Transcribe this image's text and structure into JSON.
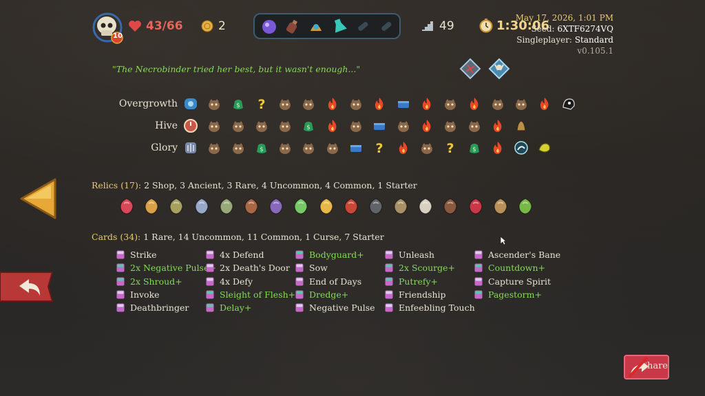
{
  "player": {
    "hp": "43/66",
    "gold": "2",
    "ascension": "10"
  },
  "potions": [
    "purple-potion",
    "brown-bottle-potion",
    "swirl-potion",
    "teal-flask-potion",
    "empty-slot",
    "empty-slot"
  ],
  "floor": "49",
  "timer": "1:30:06",
  "info": {
    "date": "May 17, 2026, 1:01 PM",
    "seed_label": "Seed:",
    "seed": "6XTF6274VQ",
    "mode_label": "Singleplayer:",
    "mode": "Standard",
    "version": "v0.105.1"
  },
  "quote": "\"The Necrobinder tried her best, but it wasn't enough...\"",
  "acts": [
    {
      "name": "Overgrowth",
      "nodes": [
        "ancient-blue",
        "monster",
        "shop",
        "unknown",
        "monster",
        "monster",
        "elite",
        "monster",
        "elite",
        "chest",
        "elite",
        "monster",
        "elite",
        "monster",
        "monster",
        "elite",
        "boss-black"
      ]
    },
    {
      "name": "Hive",
      "nodes": [
        "ancient-clock",
        "monster",
        "monster",
        "monster",
        "monster",
        "shop",
        "elite",
        "monster",
        "chest",
        "monster",
        "elite",
        "monster",
        "monster",
        "elite",
        "boss-bell"
      ]
    },
    {
      "name": "Glory",
      "nodes": [
        "ancient-grey",
        "monster",
        "monster",
        "shop",
        "monster",
        "monster",
        "monster",
        "chest",
        "unknown",
        "elite",
        "monster",
        "unknown",
        "shop",
        "elite",
        "boss-teal",
        "boss-yellow"
      ]
    }
  ],
  "relics": {
    "label": "Relics (17):",
    "summary": "2 Shop,  3 Ancient,  3 Rare,  4 Uncommon,  4 Common,  1 Starter",
    "items": [
      "#d84858",
      "#d8a048",
      "#a8a060",
      "#98a8c8",
      "#98a878",
      "#a86848",
      "#8868b8",
      "#78c868",
      "#e8b848",
      "#c84838",
      "#606468",
      "#a89068",
      "#d8d0c0",
      "#8a5a40",
      "#c83848",
      "#b89058",
      "#78b848"
    ]
  },
  "cards": {
    "label": "Cards (34):",
    "summary": "1 Rare,  14 Uncommon,  11 Common,  1 Curse,  7 Starter",
    "columns": [
      [
        {
          "n": "Strike",
          "u": false
        },
        {
          "n": "2x Negative Pulse+",
          "u": true
        },
        {
          "n": "2x Shroud+",
          "u": true
        },
        {
          "n": "Invoke",
          "u": false
        },
        {
          "n": "Deathbringer",
          "u": false
        }
      ],
      [
        {
          "n": "4x Defend",
          "u": false
        },
        {
          "n": "2x Death's Door",
          "u": false
        },
        {
          "n": "4x Defy",
          "u": false
        },
        {
          "n": "Sleight of Flesh+",
          "u": true
        },
        {
          "n": "Delay+",
          "u": true
        }
      ],
      [
        {
          "n": "Bodyguard+",
          "u": true
        },
        {
          "n": "Sow",
          "u": false
        },
        {
          "n": "End of Days",
          "u": false
        },
        {
          "n": "Dredge+",
          "u": true
        },
        {
          "n": "Negative Pulse",
          "u": false
        }
      ],
      [
        {
          "n": "Unleash",
          "u": false
        },
        {
          "n": "2x Scourge+",
          "u": true
        },
        {
          "n": "Putrefy+",
          "u": true
        },
        {
          "n": "Friendship",
          "u": false
        },
        {
          "n": "Enfeebling Touch",
          "u": false
        }
      ],
      [
        {
          "n": "Ascender's Bane",
          "u": false
        },
        {
          "n": "Countdown+",
          "u": true
        },
        {
          "n": "Capture Spirit",
          "u": false
        },
        {
          "n": "Pagestorm+",
          "u": true
        }
      ]
    ]
  },
  "share_label": "Share"
}
